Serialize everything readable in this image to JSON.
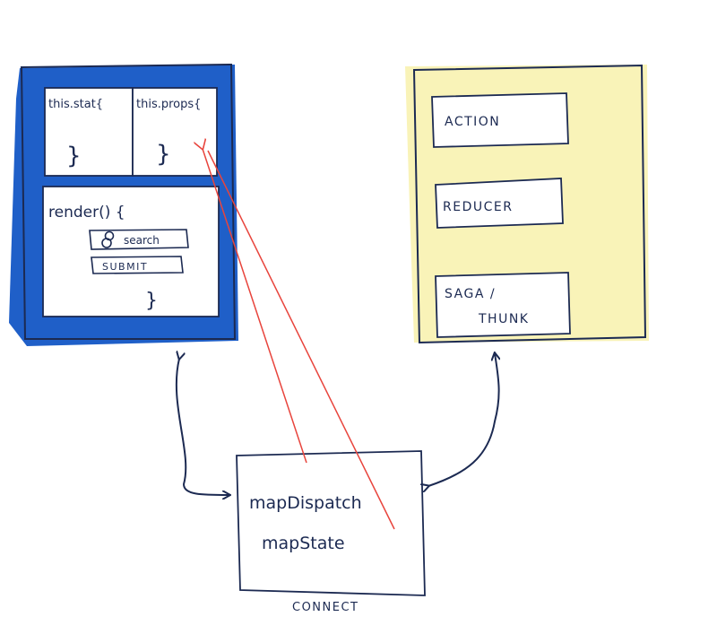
{
  "colors": {
    "component_fill": "#1f5fc8",
    "store_fill": "#f9f3b8",
    "ink": "#1c2a52",
    "arrow_red": "#e8443c"
  },
  "component": {
    "state_label": "this.stat{",
    "state_close": "}",
    "props_label": "this.props{",
    "props_close": "}",
    "render_label": "render() {",
    "search_label": "search",
    "search_icon": "search-icon",
    "submit_label": "SUBMIT",
    "render_close": "}"
  },
  "store": {
    "action_label": "ACTION",
    "reducer_label": "REDUCER",
    "saga_label_line1": "SAGA /",
    "saga_label_line2": "THUNK"
  },
  "connect": {
    "map_dispatch": "mapDispatch",
    "map_state": "mapState",
    "caption": "CONNECT"
  }
}
